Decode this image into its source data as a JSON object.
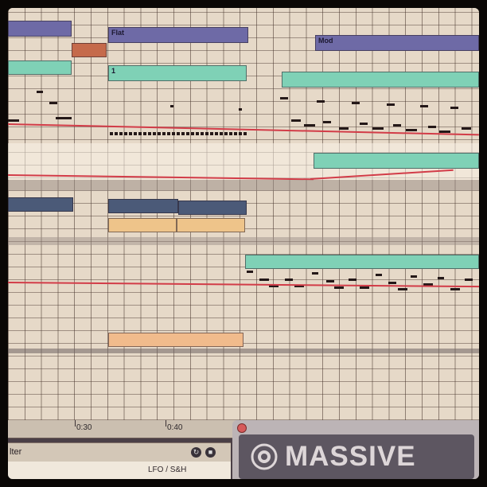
{
  "arrangement": {
    "clips": [
      {
        "color": "#6e6aa6",
        "label": ""
      },
      {
        "color": "#6e6aa6",
        "label": "Flat"
      },
      {
        "color": "#6e6aa6",
        "label": "Mod"
      },
      {
        "color": "#c56a4b",
        "label": ""
      },
      {
        "color": "#7fd1b6",
        "label": ""
      },
      {
        "color": "#7fd1b6",
        "label": "1"
      },
      {
        "color": "#7fd1b6",
        "label": ""
      },
      {
        "color": "#7fd1b6",
        "label": ""
      },
      {
        "color": "#4b5a78",
        "label": ""
      },
      {
        "color": "#eec48a",
        "label": ""
      },
      {
        "color": "#7fd1b6",
        "label": ""
      },
      {
        "color": "#f1bb8c",
        "label": ""
      }
    ],
    "automation_color": "#d23c48"
  },
  "ruler": {
    "ticks": [
      "0:30",
      "0:40"
    ]
  },
  "device": {
    "title_partial": "lter",
    "section_label": "LFO / S&H"
  },
  "massive": {
    "brand": "MASSIVE"
  }
}
